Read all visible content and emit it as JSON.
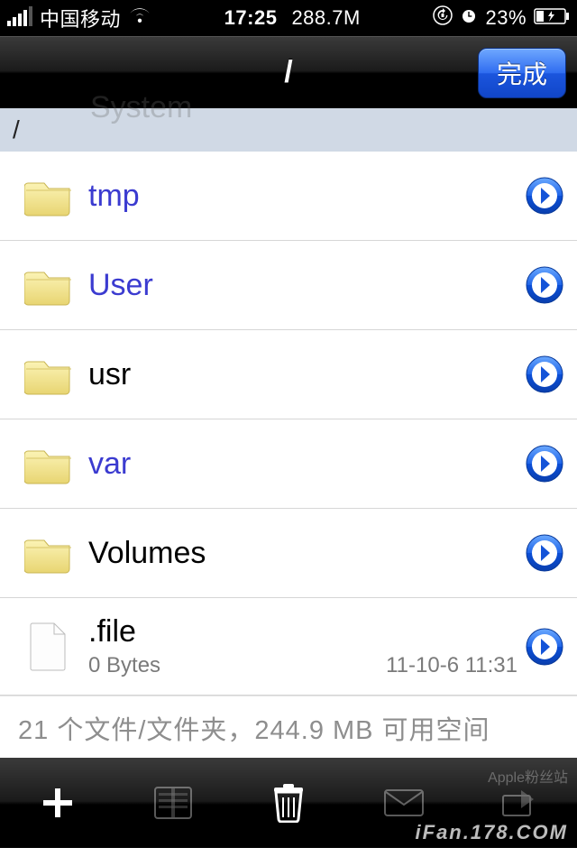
{
  "status_bar": {
    "carrier": "中国移动",
    "time": "17:25",
    "memory": "288.7M",
    "battery_pct": "23",
    "battery_suffix": "%"
  },
  "nav": {
    "title": "/",
    "done": "完成"
  },
  "breadcrumb": {
    "path": "/",
    "ghost": "System"
  },
  "rows": [
    {
      "name": "tmp",
      "kind": "folder",
      "style": "link"
    },
    {
      "name": "User",
      "kind": "folder",
      "style": "link"
    },
    {
      "name": "usr",
      "kind": "folder",
      "style": "plain"
    },
    {
      "name": "var",
      "kind": "folder",
      "style": "link"
    },
    {
      "name": "Volumes",
      "kind": "folder",
      "style": "plain"
    },
    {
      "name": ".file",
      "kind": "file",
      "style": "plain",
      "size": "0 Bytes",
      "date": "11-10-6 11:31"
    }
  ],
  "summary": "21 个文件/文件夹，244.9 MB 可用空间",
  "watermark": {
    "small": "Apple粉丝站",
    "big": "iFan.178.COM"
  }
}
